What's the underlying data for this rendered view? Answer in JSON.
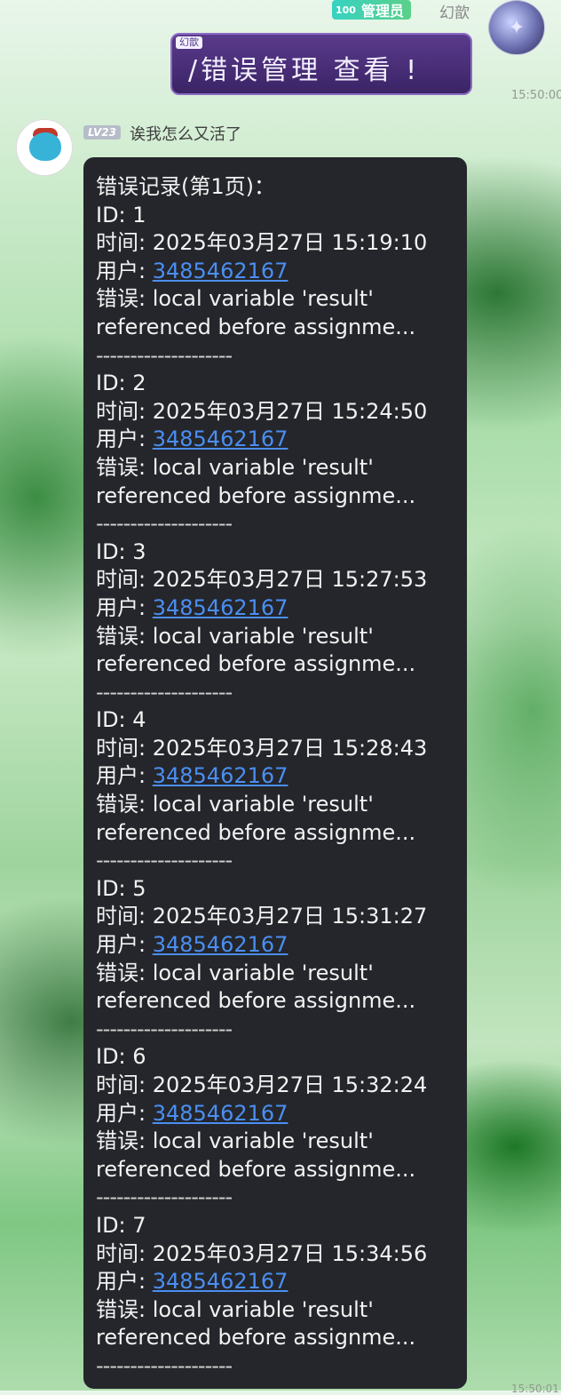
{
  "header": {
    "admin_level": "100",
    "admin_badge": "管理员",
    "sender_name": "幻歆",
    "command_tag": "幻歆",
    "command_text": "/错误管理 查看 !",
    "time": "15:50:00"
  },
  "reply": {
    "level": "LV23",
    "bot_name": "诶我怎么又活了",
    "title": "错误记录(第1页)：",
    "entries": [
      {
        "id": "ID: 1",
        "time": "时间: 2025年03月27日 15:19:10",
        "user_label": "用户: ",
        "user": "3485462167",
        "err1": "错误: local variable 'result'",
        "err2": "referenced before assignme...",
        "sep": "--------------------"
      },
      {
        "id": "ID: 2",
        "time": "时间: 2025年03月27日 15:24:50",
        "user_label": "用户: ",
        "user": "3485462167",
        "err1": "错误: local variable 'result'",
        "err2": "referenced before assignme...",
        "sep": "--------------------"
      },
      {
        "id": "ID: 3",
        "time": "时间: 2025年03月27日 15:27:53",
        "user_label": "用户: ",
        "user": "3485462167",
        "err1": "错误: local variable 'result'",
        "err2": "referenced before assignme...",
        "sep": "--------------------"
      },
      {
        "id": "ID: 4",
        "time": "时间: 2025年03月27日 15:28:43",
        "user_label": "用户: ",
        "user": "3485462167",
        "err1": "错误: local variable 'result'",
        "err2": "referenced before assignme...",
        "sep": "--------------------"
      },
      {
        "id": "ID: 5",
        "time": "时间: 2025年03月27日 15:31:27",
        "user_label": "用户: ",
        "user": "3485462167",
        "err1": "错误: local variable 'result'",
        "err2": "referenced before assignme...",
        "sep": "--------------------"
      },
      {
        "id": "ID: 6",
        "time": "时间: 2025年03月27日 15:32:24",
        "user_label": "用户: ",
        "user": "3485462167",
        "err1": "错误: local variable 'result'",
        "err2": "referenced before assignme...",
        "sep": "--------------------"
      },
      {
        "id": "ID: 7",
        "time": "时间: 2025年03月27日 15:34:56",
        "user_label": "用户: ",
        "user": "3485462167",
        "err1": "错误: local variable 'result'",
        "err2": "referenced before assignme...",
        "sep": "--------------------"
      }
    ],
    "time": "15:50:01"
  }
}
